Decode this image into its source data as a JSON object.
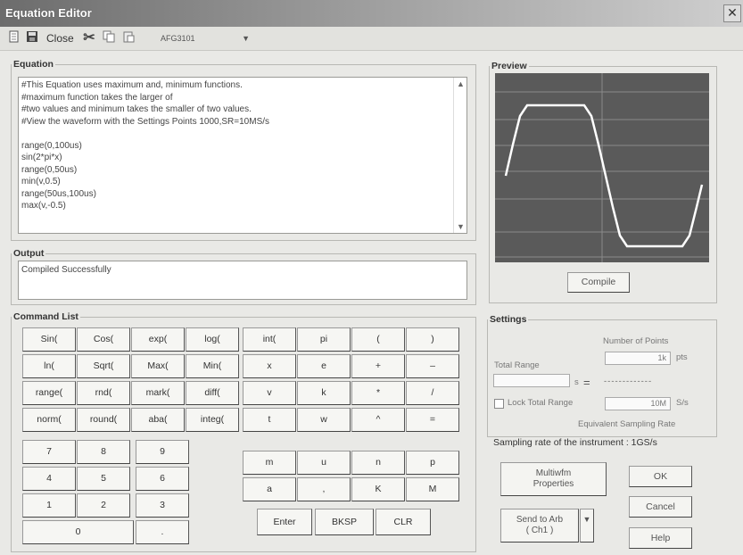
{
  "window": {
    "title": "Equation Editor"
  },
  "toolbar": {
    "new_icon": "new-file-icon",
    "save_icon": "save-icon",
    "close_label": "Close",
    "cut_icon": "cut-icon",
    "copy_icon": "copy-icon",
    "paste_icon": "paste-icon",
    "instrument_value": "AFG3101"
  },
  "equation": {
    "legend": "Equation",
    "text": "#This Equation uses maximum and, minimum functions.\n#maximum function takes the larger of\n#two values and minimum takes the smaller of two values.\n#View the waveform with the Settings Points 1000,SR=10MS/s\n\nrange(0,100us)\nsin(2*pi*x)\nrange(0,50us)\nmin(v,0.5)\nrange(50us,100us)\nmax(v,-0.5)"
  },
  "output": {
    "legend": "Output",
    "text": "Compiled Successfully"
  },
  "preview": {
    "legend": "Preview",
    "compile_label": "Compile"
  },
  "command_list": {
    "legend": "Command List",
    "rows": [
      [
        "Sin(",
        "Cos(",
        "exp(",
        "log(",
        "int(",
        "pi",
        "(",
        ")"
      ],
      [
        "ln(",
        "Sqrt(",
        "Max(",
        "Min(",
        "x",
        "e",
        "+",
        "–"
      ],
      [
        "range(",
        "rnd(",
        "mark(",
        "diff(",
        "v",
        "k",
        "*",
        "/"
      ],
      [
        "norm(",
        "round(",
        "aba(",
        "integ(",
        "t",
        "w",
        "^",
        "="
      ]
    ],
    "numpad": [
      [
        "7",
        "8",
        "9"
      ],
      [
        "4",
        "5",
        "6"
      ],
      [
        "1",
        "2",
        "3"
      ]
    ],
    "zero": "0",
    "dot": ".",
    "units": [
      [
        "m",
        "u",
        "n",
        "p"
      ],
      [
        "a",
        ",",
        "K",
        "M"
      ]
    ],
    "enter": "Enter",
    "bksp": "BKSP",
    "clr": "CLR"
  },
  "settings": {
    "legend": "Settings",
    "number_of_points_label": "Number of Points",
    "points_value": "1k",
    "points_unit": "pts",
    "total_range_label": "Total Range",
    "total_range_unit": "s",
    "equals": "=",
    "dashes": "-------------",
    "lock_label": "Lock Total Range",
    "rate_value": "10M",
    "rate_unit": "S/s",
    "equiv_rate_label": "Equivalent Sampling Rate",
    "instrument_rate": "Sampling rate of the instrument : 1GS/s"
  },
  "buttons": {
    "multiwfm": "Multiwfm\nProperties",
    "send_to_arb": "Send to Arb\n( Ch1 )",
    "ok": "OK",
    "cancel": "Cancel",
    "help": "Help"
  }
}
